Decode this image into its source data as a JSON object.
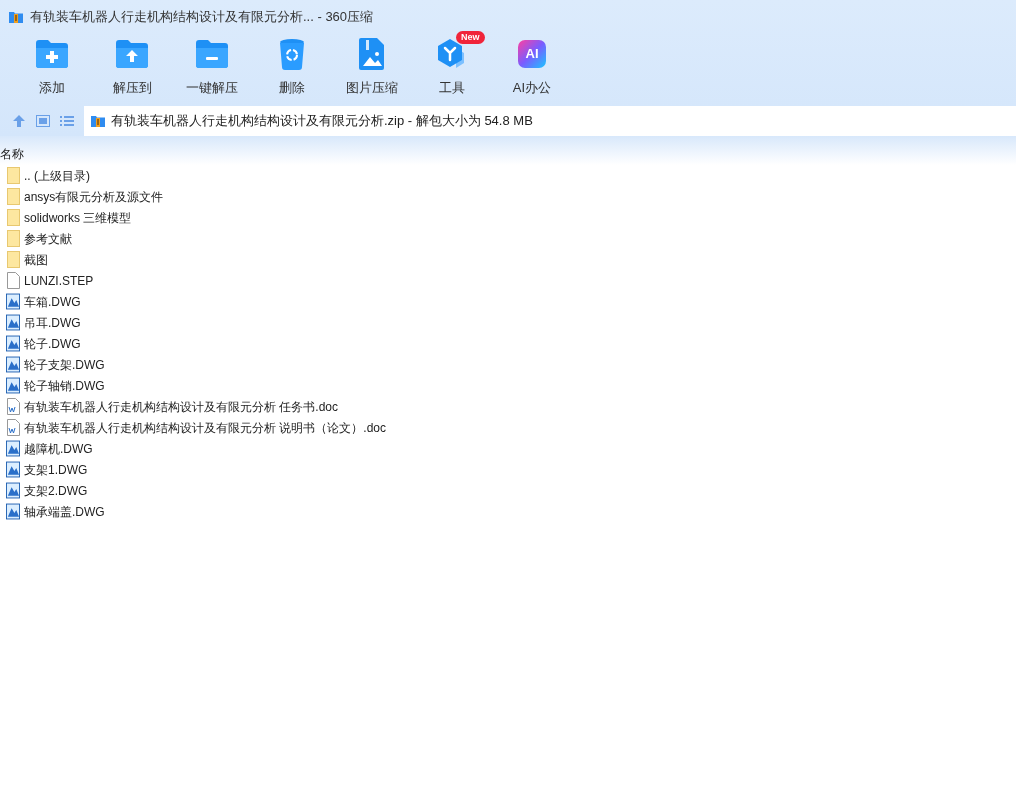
{
  "window": {
    "title": "有轨装车机器人行走机构结构设计及有限元分析... - 360压缩"
  },
  "toolbar": [
    {
      "kind": "add",
      "label": "添加"
    },
    {
      "kind": "extract",
      "label": "解压到"
    },
    {
      "kind": "oneclick",
      "label": "一键解压"
    },
    {
      "kind": "delete",
      "label": "删除"
    },
    {
      "kind": "image",
      "label": "图片压缩"
    },
    {
      "kind": "tools",
      "label": "工具",
      "badge": "New"
    },
    {
      "kind": "ai",
      "label": "AI办公",
      "icon_text": "AI"
    }
  ],
  "address_bar": {
    "path": "有轨装车机器人行走机构结构设计及有限元分析.zip - 解包大小为 54.8 MB"
  },
  "file_list": {
    "columns": [
      "名称"
    ],
    "rows": [
      {
        "kind": "folder",
        "name": ".. (上级目录)"
      },
      {
        "kind": "folder",
        "name": "ansys有限元分析及源文件"
      },
      {
        "kind": "folder",
        "name": "solidworks 三维模型"
      },
      {
        "kind": "folder",
        "name": "参考文献"
      },
      {
        "kind": "folder",
        "name": "截图"
      },
      {
        "kind": "file",
        "name": "LUNZI.STEP"
      },
      {
        "kind": "dwg",
        "name": "车箱.DWG"
      },
      {
        "kind": "dwg",
        "name": "吊耳.DWG"
      },
      {
        "kind": "dwg",
        "name": "轮子.DWG"
      },
      {
        "kind": "dwg",
        "name": "轮子支架.DWG"
      },
      {
        "kind": "dwg",
        "name": "轮子轴销.DWG"
      },
      {
        "kind": "doc",
        "name": "有轨装车机器人行走机构结构设计及有限元分析 任务书.doc"
      },
      {
        "kind": "doc",
        "name": "有轨装车机器人行走机构结构设计及有限元分析 说明书（论文）.doc"
      },
      {
        "kind": "dwg",
        "name": "越障机.DWG"
      },
      {
        "kind": "dwg",
        "name": "支架1.DWG"
      },
      {
        "kind": "dwg",
        "name": "支架2.DWG"
      },
      {
        "kind": "dwg",
        "name": "轴承端盖.DWG"
      }
    ]
  }
}
